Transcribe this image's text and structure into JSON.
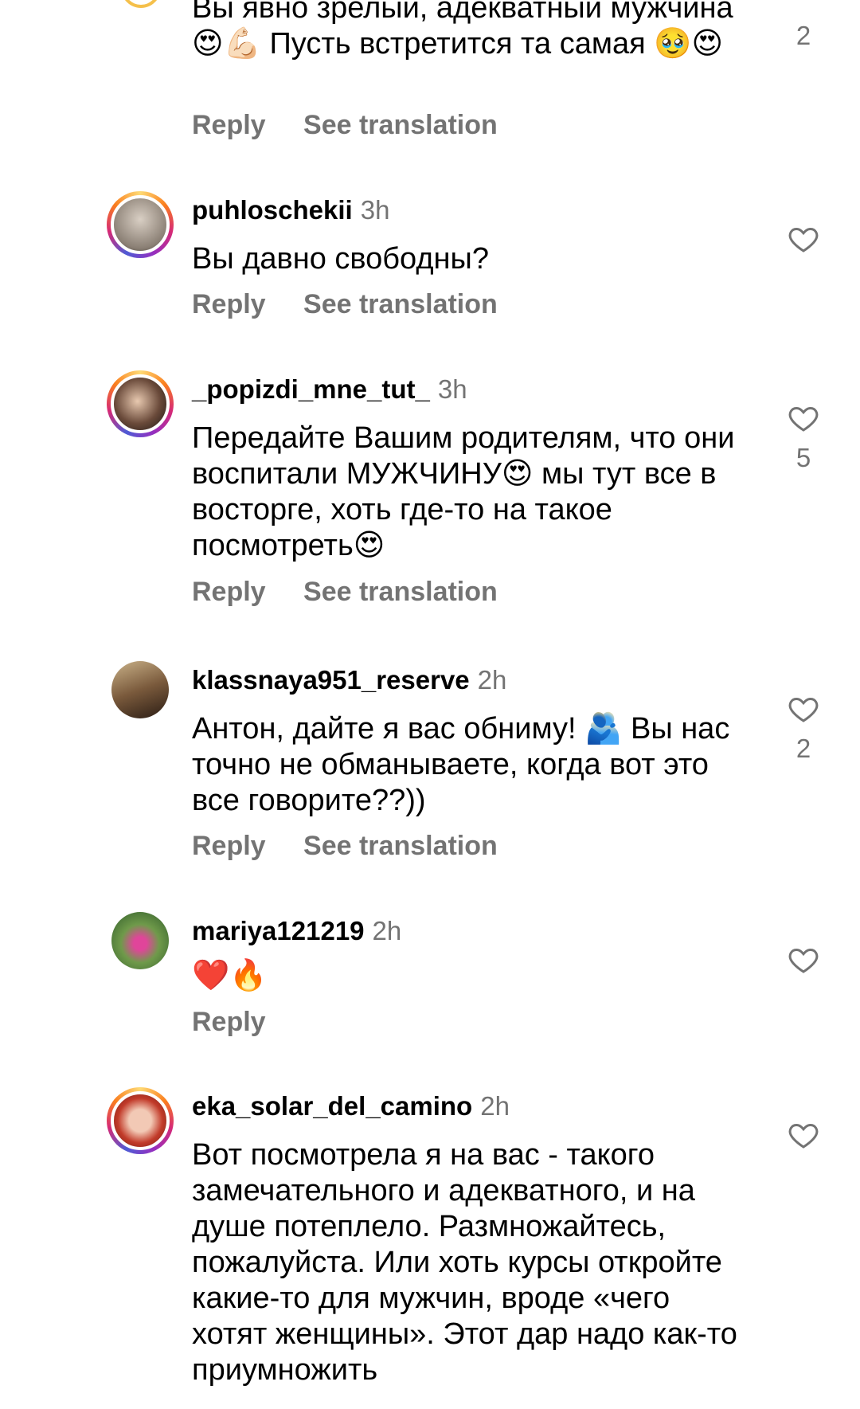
{
  "comments": [
    {
      "username": "",
      "time": "",
      "text": "Вы явно зрелый, адекватный мужчина 😍💪🏻 Пусть встретится та самая 🥹😍",
      "reply": "Reply",
      "translate": "See translation",
      "likes": "2"
    },
    {
      "username": "puhloschekii",
      "time": "3h",
      "text": "Вы давно свободны?",
      "reply": "Reply",
      "translate": "See translation",
      "likes": ""
    },
    {
      "username": "_popizdi_mne_tut_",
      "time": "3h",
      "text": "Передайте Вашим родителям, что они воспитали МУЖЧИНУ😍 мы тут все в восторге, хоть где-то на такое посмотреть😍",
      "reply": "Reply",
      "translate": "See translation",
      "likes": "5"
    },
    {
      "username": "klassnaya951_reserve",
      "time": "2h",
      "text": "Антон, дайте я вас обниму! 🫂 Вы нас точно не обманываете, когда вот это все говорите??))",
      "reply": "Reply",
      "translate": "See translation",
      "likes": "2"
    },
    {
      "username": "mariya121219",
      "time": "2h",
      "text": "❤️🔥",
      "reply": "Reply",
      "translate": "",
      "likes": ""
    },
    {
      "username": "eka_solar_del_camino",
      "time": "2h",
      "text": "Вот посмотрела я на вас - такого замечательного и адекватного, и на душе потеплело. Размножайтесь, пожалуйста. Или хоть курсы откройте какие-то для мужчин, вроде «чего хотят женщины». Этот дар надо как-то приумножить",
      "reply": "",
      "translate": "",
      "likes": ""
    }
  ],
  "icons": {
    "like": "heart-outline-icon"
  },
  "colors": {
    "secondary_text": "#737373",
    "primary_text": "#000000"
  }
}
